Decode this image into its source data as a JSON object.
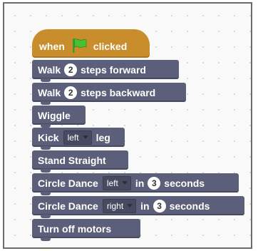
{
  "script": {
    "hat": {
      "prefix": "when",
      "suffix": "clicked",
      "icon": "green-flag-icon",
      "color": "#c98d2c"
    },
    "block_color": "#5c5f7a",
    "blocks": [
      {
        "text1": "Walk",
        "num": "2",
        "text2": "steps forward"
      },
      {
        "text1": "Walk",
        "num": "2",
        "text2": "steps backward"
      },
      {
        "text": "Wiggle"
      },
      {
        "text1": "Kick",
        "dropdown": "left",
        "text2": "leg"
      },
      {
        "text": "Stand Straight"
      },
      {
        "text1": "Circle Dance",
        "dropdown": "left",
        "text2": "in",
        "num": "3",
        "text3": "seconds"
      },
      {
        "text1": "Circle Dance",
        "dropdown": "right",
        "text2": "in",
        "num": "3",
        "text3": "seconds"
      },
      {
        "text": "Turn off motors"
      }
    ]
  }
}
